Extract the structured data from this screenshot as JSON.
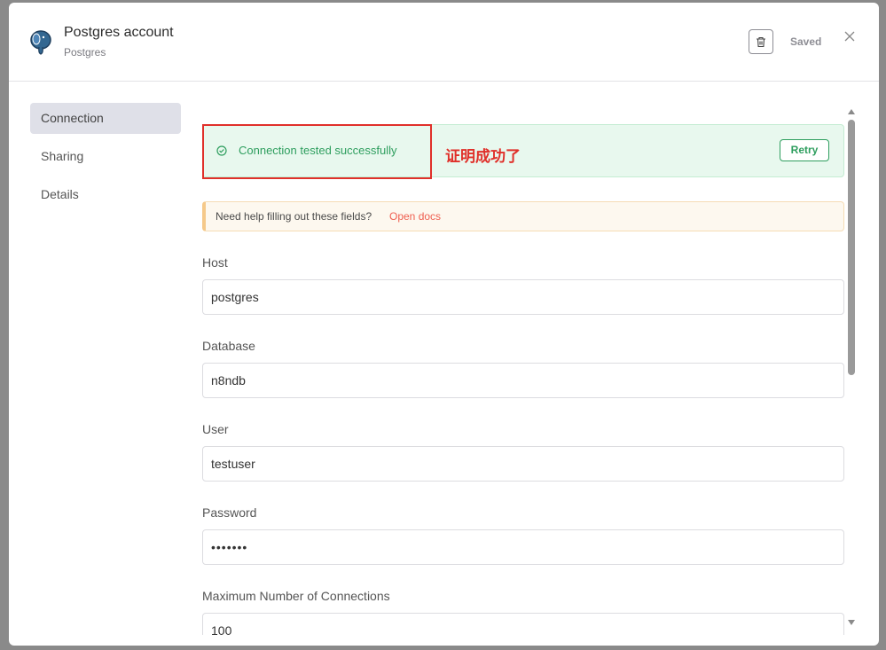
{
  "header": {
    "title": "Postgres account",
    "subtitle": "Postgres",
    "saved_label": "Saved"
  },
  "sidebar": {
    "items": [
      {
        "label": "Connection",
        "active": true
      },
      {
        "label": "Sharing",
        "active": false
      },
      {
        "label": "Details",
        "active": false
      }
    ]
  },
  "status": {
    "message": "Connection tested successfully",
    "retry_label": "Retry",
    "annotation": "证明成功了",
    "colors": {
      "success": "#2e9e5e",
      "annotation": "#e0302a"
    }
  },
  "help": {
    "text": "Need help filling out these fields?",
    "link": "Open docs"
  },
  "fields": [
    {
      "label": "Host",
      "value": "postgres"
    },
    {
      "label": "Database",
      "value": "n8ndb"
    },
    {
      "label": "User",
      "value": "testuser"
    },
    {
      "label": "Password",
      "value": "•••••••"
    },
    {
      "label": "Maximum Number of Connections",
      "value": "100"
    }
  ],
  "icons": {
    "logo": "postgres-elephant-icon",
    "delete": "trash-icon",
    "close": "close-icon",
    "success": "check-circle-icon"
  }
}
